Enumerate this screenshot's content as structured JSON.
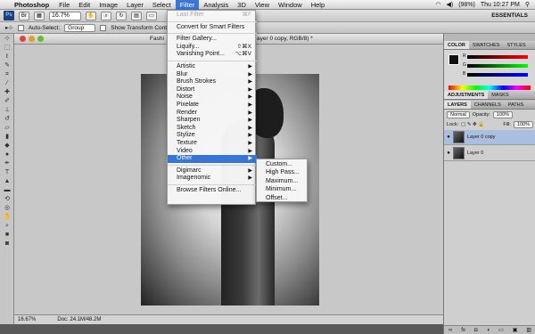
{
  "menubar": {
    "app_name": "Photoshop",
    "items": [
      "File",
      "Edit",
      "Image",
      "Layer",
      "Select",
      "Filter",
      "Analysis",
      "3D",
      "View",
      "Window",
      "Help"
    ],
    "active_item": "Filter",
    "battery": "(98%)",
    "clock": "Thu 10:27 PM"
  },
  "appbar": {
    "zoom": "16.7%",
    "workspace": "ESSENTIALS"
  },
  "optionsbar": {
    "auto_select_label": "Auto-Select:",
    "auto_select_value": "Group",
    "transform_label": "Show Transform Controls"
  },
  "document": {
    "title_left": "Fashi",
    "title_right": "ayer 0 copy, RGB/8) *",
    "status_zoom": "16.67%",
    "status_doc": "Doc: 24.1M/48.2M"
  },
  "filter_menu": {
    "items": [
      {
        "label": "Last Filter",
        "shortcut": "⌘F",
        "disabled": true
      },
      {
        "sep": true
      },
      {
        "label": "Convert for Smart Filters"
      },
      {
        "sep": true
      },
      {
        "label": "Filter Gallery..."
      },
      {
        "label": "Liquify...",
        "shortcut": "⇧⌘X"
      },
      {
        "label": "Vanishing Point...",
        "shortcut": "⌥⌘V"
      },
      {
        "sep": true
      },
      {
        "label": "Artistic",
        "submenu": true
      },
      {
        "label": "Blur",
        "submenu": true
      },
      {
        "label": "Brush Strokes",
        "submenu": true
      },
      {
        "label": "Distort",
        "submenu": true
      },
      {
        "label": "Noise",
        "submenu": true
      },
      {
        "label": "Pixelate",
        "submenu": true
      },
      {
        "label": "Render",
        "submenu": true
      },
      {
        "label": "Sharpen",
        "submenu": true
      },
      {
        "label": "Sketch",
        "submenu": true
      },
      {
        "label": "Stylize",
        "submenu": true
      },
      {
        "label": "Texture",
        "submenu": true
      },
      {
        "label": "Video",
        "submenu": true
      },
      {
        "label": "Other",
        "submenu": true,
        "highlighted": true
      },
      {
        "sep": true
      },
      {
        "label": "Digimarc",
        "submenu": true
      },
      {
        "label": "Imagenomic",
        "submenu": true
      },
      {
        "sep": true
      },
      {
        "label": "Browse Filters Online..."
      }
    ]
  },
  "other_submenu": [
    "Custom...",
    "High Pass...",
    "Maximum...",
    "Minimum...",
    "Offset..."
  ],
  "panels": {
    "color_tabs": [
      "COLOR",
      "SWATCHES",
      "STYLES"
    ],
    "color_labels": [
      "R",
      "G",
      "B"
    ],
    "adjust_tabs": [
      "ADJUSTMENTS",
      "MASKS"
    ],
    "layers_tabs": [
      "LAYERS",
      "CHANNELS",
      "PATHS"
    ],
    "blend_mode": "Normal",
    "opacity_label": "Opacity:",
    "opacity_value": "100%",
    "lock_label": "Lock:",
    "fill_label": "Fill:",
    "fill_value": "100%",
    "layers": [
      {
        "name": "Layer 0 copy",
        "selected": true
      },
      {
        "name": "Layer 0",
        "selected": false
      }
    ]
  },
  "colors": {
    "menu_highlight": "#3875d7",
    "layer_selected": "#a8bfdf"
  }
}
